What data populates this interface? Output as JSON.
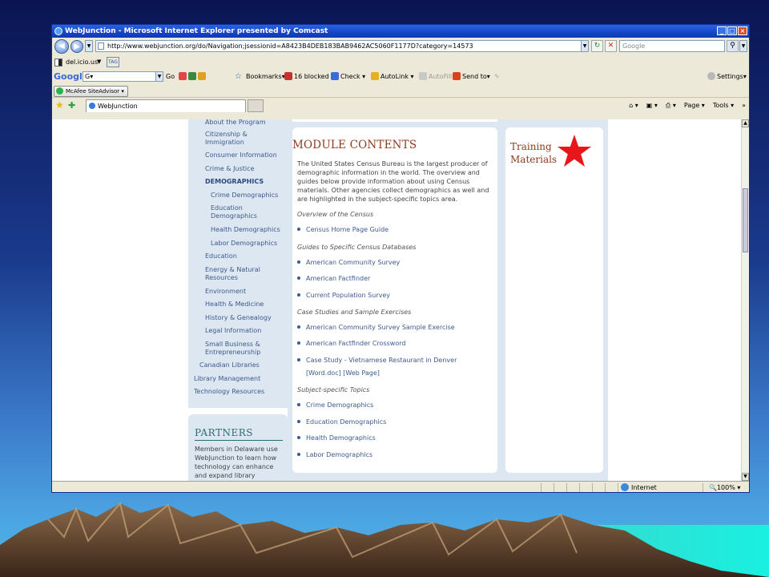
{
  "browser": {
    "title": "WebJunction - Microsoft Internet Explorer presented by Comcast",
    "window_buttons": [
      "_",
      "□",
      "×"
    ],
    "address": "http://www.webjunction.org/do/Navigation;jsessionid=A8423B4DEB183BAB9462AC5060F1177D?category=14573",
    "search_placeholder": "Google",
    "delicious_label": "del.icio.us",
    "tag_label": "TAG",
    "toolbar": {
      "google_label": "Google",
      "google_input": "G▾",
      "go_label": "Go",
      "bookmarks": "Bookmarks▾",
      "blocked": "16 blocked",
      "check": "Check",
      "autolink": "AutoLink",
      "autofill": "AutoFill",
      "sendto": "Send to▾",
      "settings": "Settings▾"
    },
    "mcafee": "McAfee SiteAdvisor ▾",
    "tab_label": "WebJunction",
    "command_bar": {
      "page": "Page ▾",
      "tools": "Tools ▾"
    },
    "status": {
      "zone": "Internet",
      "zoom": "100%"
    }
  },
  "left_nav": {
    "items": [
      "About the Program",
      "Citizenship &",
      "Immigration",
      "Consumer Information",
      "Crime & Justice",
      "DEMOGRAPHICS",
      "Crime Demographics",
      "Education",
      "Demographics",
      "Health Demographics",
      "Labor Demographics",
      "Education",
      "Energy & Natural",
      "Resources",
      "Environment",
      "Health & Medicine",
      "History & Genealogy",
      "Legal Information",
      "Small Business &",
      "Entrepreneurship",
      "Canadian Libraries",
      "Library Management",
      "Technology Resources"
    ]
  },
  "partners": {
    "title": "PARTNERS",
    "text": "Members in Delaware use WebJunction to learn how technology can enhance and expand library services!"
  },
  "module": {
    "title": "MODULE CONTENTS",
    "description": "The United States Census Bureau is the largest producer of demographic information in the world.  The overview and guides below provide information about using Census materials.  Other agencies collect demographics as well and are highlighted in the subject-specific topics area.",
    "sections": [
      {
        "heading": "Overview of the Census",
        "links": [
          "Census Home Page Guide"
        ]
      },
      {
        "heading": "Guides to Specific Census Databases",
        "links": [
          "American Community Survey",
          "American Factfinder",
          "Current Population Survey"
        ]
      },
      {
        "heading": "Case Studies and Sample Exercises",
        "links": [
          "American Community Survey Sample Exercise",
          "American Factfinder Crossword",
          "Case Study - Vietnamese Restaurant in Denver",
          "[Word.doc] [Web Page]"
        ]
      },
      {
        "heading": "Subject-specific Topics",
        "links": [
          "Crime Demographics",
          "Education Demographics",
          "Health Demographics",
          "Labor Demographics"
        ]
      }
    ]
  },
  "training": {
    "line1": "Training",
    "line2": "Materials"
  },
  "colors": {
    "title_brown": "#8c3a1e",
    "link_blue": "#3c5a8e",
    "panel_blue": "#dce7f1",
    "star_red": "#e8161b"
  }
}
